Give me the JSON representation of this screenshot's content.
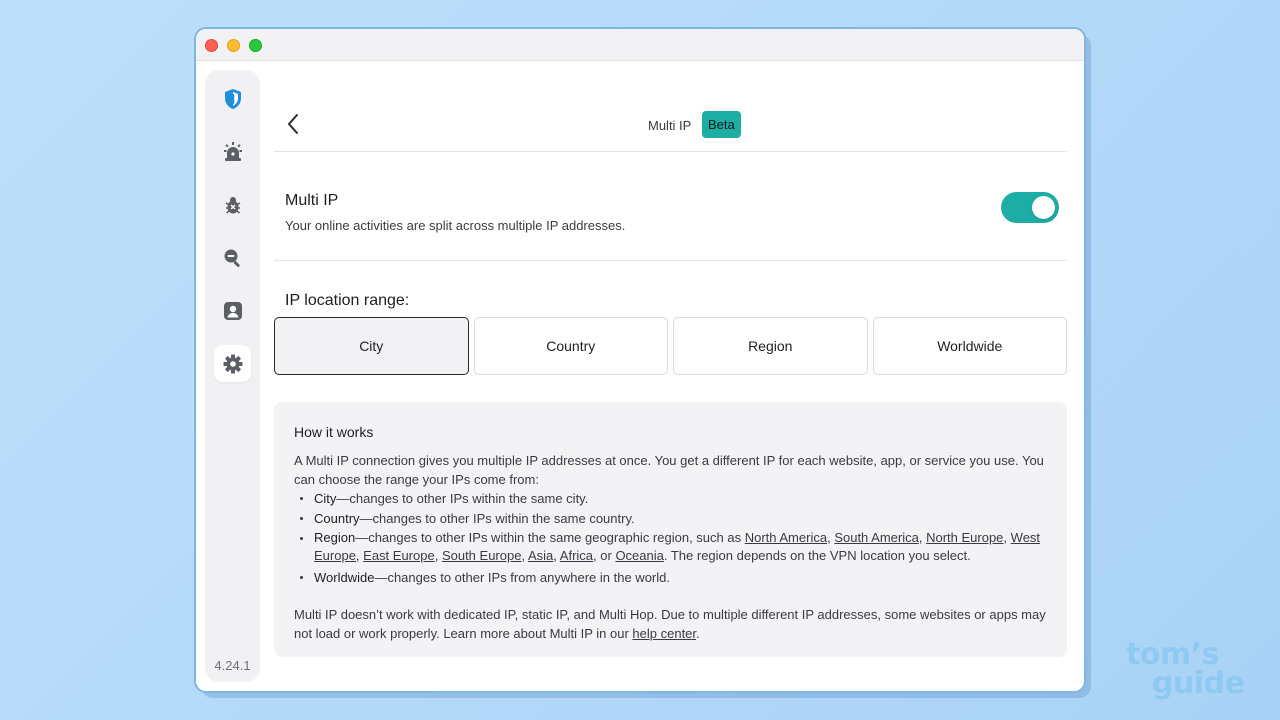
{
  "app": {
    "version": "4.24.1"
  },
  "sidebar": {
    "items": [
      {
        "icon": "shield-icon",
        "active": false
      },
      {
        "icon": "alarm-icon",
        "active": false
      },
      {
        "icon": "bug-icon",
        "active": false
      },
      {
        "icon": "search-icon",
        "active": false
      },
      {
        "icon": "profile-icon",
        "active": false
      },
      {
        "icon": "gear-icon",
        "active": true
      }
    ]
  },
  "header": {
    "title": "Multi IP",
    "badge": "Beta"
  },
  "multi_ip": {
    "title": "Multi IP",
    "description": "Your online activities are split across multiple IP addresses.",
    "enabled": true
  },
  "range": {
    "label": "IP location range:",
    "options": [
      "City",
      "Country",
      "Region",
      "Worldwide"
    ],
    "selected": "City"
  },
  "how_it_works": {
    "title": "How it works",
    "intro": "A Multi IP connection gives you multiple IP addresses at once. You get a different IP for each website, app, or service you use. You can choose the range your IPs come from:",
    "city": {
      "term": "City",
      "desc": "—changes to other IPs within the same city."
    },
    "country": {
      "term": "Country",
      "desc": "—changes to other IPs within the same country."
    },
    "region": {
      "term": "Region",
      "desc": "—changes to other IPs within the same geographic region, such as ",
      "links": [
        "North America",
        "South America",
        "North Europe",
        "West Europe",
        "East Europe",
        "South Europe",
        "Asia",
        "Africa",
        "Oceania"
      ],
      "or": "or",
      "tail": ". The region depends on the VPN location you select."
    },
    "worldwide": {
      "term": "Worldwide",
      "desc": "—changes to other IPs from anywhere in the world."
    },
    "footer": "Multi IP doesn’t work with dedicated IP, static IP, and Multi Hop. Due to multiple different IP addresses, some websites or apps may not load or work properly. Learn more about Multi IP in our ",
    "footer_link": "help center",
    "footer_end": "."
  },
  "watermark": {
    "line1": "tom’s",
    "line2": "guide"
  },
  "colors": {
    "accent": "#1dada5",
    "background": "#b7dbf9",
    "card": "#f3f3f5"
  }
}
